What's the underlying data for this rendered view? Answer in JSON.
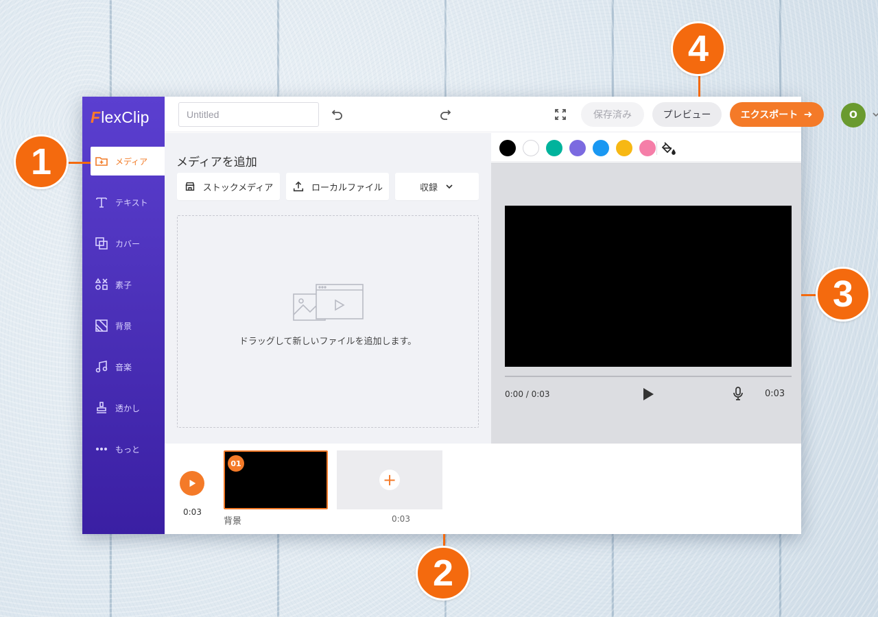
{
  "app": {
    "logo_text": "lexClip",
    "logo_letter": "F",
    "title_placeholder": "Untitled"
  },
  "sidebar": {
    "items": [
      {
        "label": "メディア",
        "icon": "media-folder-icon",
        "active": true
      },
      {
        "label": "テキスト",
        "icon": "text-icon",
        "active": false
      },
      {
        "label": "カバー",
        "icon": "overlay-icon",
        "active": false
      },
      {
        "label": "素子",
        "icon": "elements-icon",
        "active": false
      },
      {
        "label": "背景",
        "icon": "background-icon",
        "active": false
      },
      {
        "label": "音楽",
        "icon": "music-icon",
        "active": false
      },
      {
        "label": "透かし",
        "icon": "watermark-icon",
        "active": false
      },
      {
        "label": "もっと",
        "icon": "more-icon",
        "active": false
      }
    ]
  },
  "topbar": {
    "saved_label": "保存済み",
    "preview_label": "プレビュー",
    "export_label": "エクスポート",
    "avatar_initial": "O"
  },
  "media": {
    "title": "メディアを追加",
    "stock_label": "ストックメディア",
    "local_label": "ローカルファイル",
    "record_label": "収録",
    "drop_text": "ドラッグして新しいファイルを追加します。"
  },
  "colors": {
    "swatches": [
      "#000000",
      "#ffffff",
      "#00b39c",
      "#7b6ae0",
      "#1a98f2",
      "#f7b814",
      "#f57ea8"
    ],
    "accent": "#f47a28",
    "sidebar": "#4b30b8"
  },
  "player": {
    "time_current": "0:00 / 0:03",
    "duration": "0:03"
  },
  "timeline": {
    "total_time": "0:03",
    "clips": [
      {
        "number": "01",
        "label": "背景",
        "duration": "0:03"
      }
    ]
  },
  "callouts": [
    "1",
    "2",
    "3",
    "4"
  ]
}
